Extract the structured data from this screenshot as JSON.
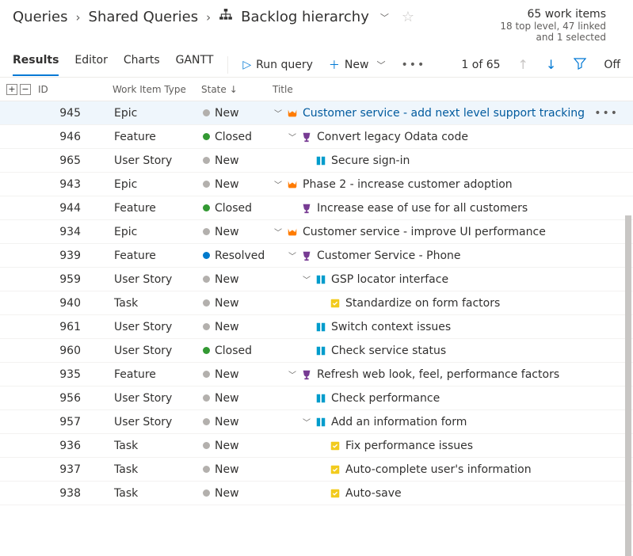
{
  "breadcrumb": {
    "root": "Queries",
    "shared": "Shared Queries",
    "title": "Backlog hierarchy"
  },
  "summary": {
    "count": "65 work items",
    "detail": "18 top level, 47 linked\nand 1 selected"
  },
  "tabs": {
    "results": "Results",
    "editor": "Editor",
    "charts": "Charts",
    "gantt": "GANTT"
  },
  "toolbar": {
    "run": "Run query",
    "new": "New",
    "pos": "1 of 65",
    "off": "Off"
  },
  "columns": {
    "id": "ID",
    "type": "Work Item Type",
    "state": "State",
    "title": "Title"
  },
  "states": {
    "new": "New",
    "closed": "Closed",
    "resolved": "Resolved"
  },
  "types": {
    "epic": "Epic",
    "feature": "Feature",
    "story": "User Story",
    "task": "Task"
  },
  "items": [
    {
      "id": 945,
      "type": "epic",
      "state": "new",
      "title": "Customer service - add next level support tracking",
      "depth": 0,
      "tw": true,
      "sel": true
    },
    {
      "id": 946,
      "type": "feature",
      "state": "closed",
      "title": "Convert legacy Odata code",
      "depth": 1,
      "tw": true
    },
    {
      "id": 965,
      "type": "story",
      "state": "new",
      "title": "Secure sign-in",
      "depth": 2,
      "tw": false
    },
    {
      "id": 943,
      "type": "epic",
      "state": "new",
      "title": "Phase 2 - increase customer adoption",
      "depth": 0,
      "tw": true
    },
    {
      "id": 944,
      "type": "feature",
      "state": "closed",
      "title": "Increase ease of use for all customers",
      "depth": 1,
      "tw": false
    },
    {
      "id": 934,
      "type": "epic",
      "state": "new",
      "title": "Customer service - improve UI performance",
      "depth": 0,
      "tw": true
    },
    {
      "id": 939,
      "type": "feature",
      "state": "resolved",
      "title": "Customer Service - Phone",
      "depth": 1,
      "tw": true
    },
    {
      "id": 959,
      "type": "story",
      "state": "new",
      "title": "GSP locator interface",
      "depth": 2,
      "tw": true
    },
    {
      "id": 940,
      "type": "task",
      "state": "new",
      "title": "Standardize on form factors",
      "depth": 3,
      "tw": false
    },
    {
      "id": 961,
      "type": "story",
      "state": "new",
      "title": "Switch context issues",
      "depth": 2,
      "tw": false
    },
    {
      "id": 960,
      "type": "story",
      "state": "closed",
      "title": "Check service status",
      "depth": 2,
      "tw": false
    },
    {
      "id": 935,
      "type": "feature",
      "state": "new",
      "title": "Refresh web look, feel, performance factors",
      "depth": 1,
      "tw": true
    },
    {
      "id": 956,
      "type": "story",
      "state": "new",
      "title": "Check performance",
      "depth": 2,
      "tw": false
    },
    {
      "id": 957,
      "type": "story",
      "state": "new",
      "title": "Add an information form",
      "depth": 2,
      "tw": true
    },
    {
      "id": 936,
      "type": "task",
      "state": "new",
      "title": "Fix performance issues",
      "depth": 3,
      "tw": false
    },
    {
      "id": 937,
      "type": "task",
      "state": "new",
      "title": "Auto-complete user's information",
      "depth": 3,
      "tw": false
    },
    {
      "id": 938,
      "type": "task",
      "state": "new",
      "title": "Auto-save",
      "depth": 3,
      "tw": false
    }
  ],
  "icons": {
    "epic": {
      "glyph": "♛",
      "color": "#ff7b00"
    },
    "feature": {
      "glyph": "🏆",
      "color": "#773b93"
    },
    "story": {
      "glyph": "▮▮",
      "color": "#009ccc"
    },
    "task": {
      "glyph": "▤",
      "color": "#f2cb1d"
    }
  }
}
